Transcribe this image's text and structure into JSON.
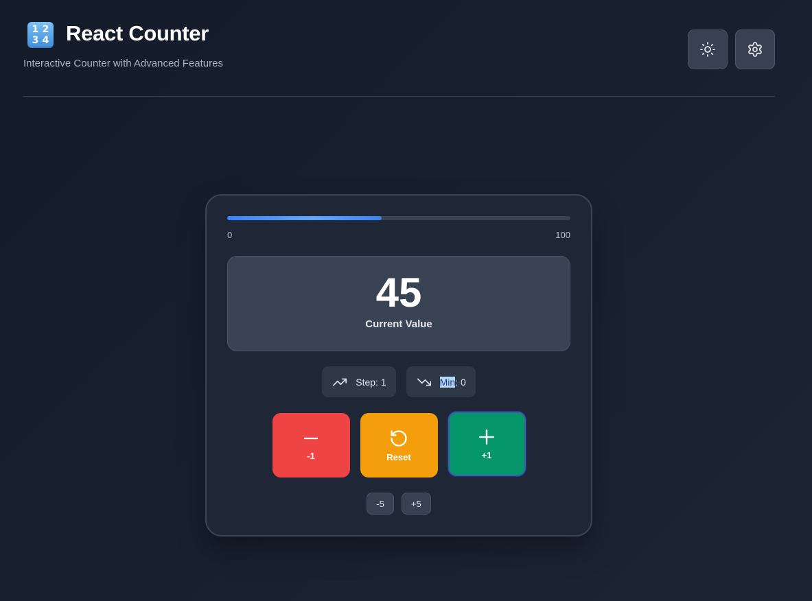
{
  "header": {
    "emoji_digits": [
      "1",
      "2",
      "3",
      "4"
    ],
    "title": "React Counter",
    "subtitle": "Interactive Counter with Advanced Features",
    "actions": [
      {
        "icon": "sun-icon"
      },
      {
        "icon": "gear-icon"
      }
    ]
  },
  "counter": {
    "progress_fraction": 0.45,
    "range_min": "0",
    "range_max": "100",
    "value": "45",
    "value_label": "Current Value",
    "step_chip": {
      "icon": "trending-up-icon",
      "label": "Step: 1"
    },
    "min_chip": {
      "icon": "trending-down-icon",
      "label_highlight": "Min",
      "label_rest": ": 0"
    },
    "buttons": {
      "decrement": {
        "icon": "minus-icon",
        "label": "-1",
        "color": "#ef4444"
      },
      "reset": {
        "icon": "rotate-ccw-icon",
        "label": "Reset",
        "color": "#f59e0b"
      },
      "increment": {
        "icon": "plus-icon",
        "label": "+1",
        "color": "#059669"
      }
    },
    "quick_buttons": {
      "minus_five": "-5",
      "plus_five": "+5"
    }
  },
  "colors": {
    "background": "#171f2d",
    "card": "#1f2737",
    "accent": "#3b82f6"
  }
}
